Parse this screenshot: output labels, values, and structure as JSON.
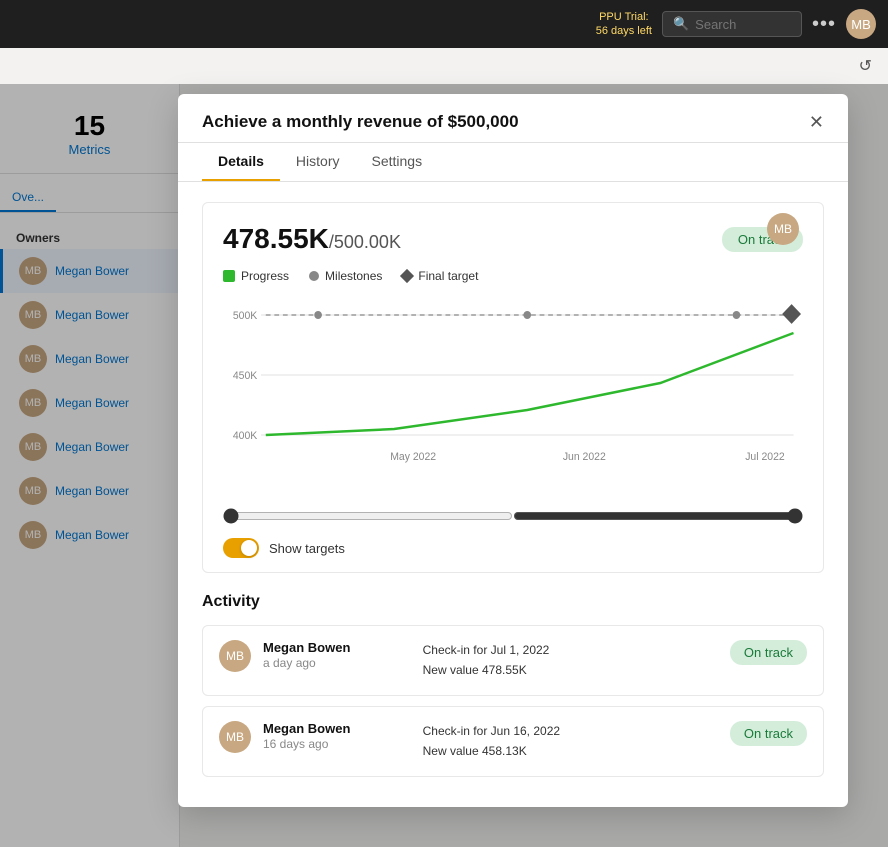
{
  "topbar": {
    "ppu_trial_line1": "PPU Trial:",
    "ppu_trial_line2": "56 days left",
    "search_placeholder": "Search",
    "more_icon": "•••",
    "avatar_initials": "MB"
  },
  "reload_icon": "↺",
  "sidebar": {
    "metrics_count": "15",
    "metrics_label": "Metrics",
    "tabs": [
      {
        "label": "Ove...",
        "active": false
      }
    ],
    "section_label": "Owners",
    "owners": [
      {
        "name": "Megan Bower",
        "selected": true
      },
      {
        "name": "Megan Bower",
        "selected": false
      },
      {
        "name": "Megan Bower",
        "selected": false
      },
      {
        "name": "Megan Bower",
        "selected": false
      },
      {
        "name": "Megan Bower",
        "selected": false
      },
      {
        "name": "Megan Bower",
        "selected": false
      },
      {
        "name": "Megan Bower",
        "selected": false
      }
    ]
  },
  "modal": {
    "title": "Achieve a monthly revenue of $500,000",
    "close_icon": "✕",
    "tabs": [
      {
        "label": "Details",
        "active": true
      },
      {
        "label": "History",
        "active": false
      },
      {
        "label": "Settings",
        "active": false
      }
    ],
    "chart": {
      "current_value": "478.55K",
      "separator": "/",
      "target_value": "500.00K",
      "badge": "On track",
      "legend": [
        {
          "type": "green-box",
          "label": "Progress"
        },
        {
          "type": "gray-dot",
          "label": "Milestones"
        },
        {
          "type": "diamond",
          "label": "Final target"
        }
      ],
      "y_labels": [
        "500K",
        "450K",
        "400K"
      ],
      "x_labels": [
        "May 2022",
        "Jun 2022",
        "Jul 2022"
      ],
      "toggle_label": "Show targets"
    },
    "activity": {
      "title": "Activity",
      "items": [
        {
          "name": "Megan Bowen",
          "time": "a day ago",
          "checkin": "Check-in for Jul 1, 2022",
          "new_value": "New value 478.55K",
          "badge": "On track"
        },
        {
          "name": "Megan Bowen",
          "time": "16 days ago",
          "checkin": "Check-in for Jun 16, 2022",
          "new_value": "New value 458.13K",
          "badge": "On track"
        }
      ]
    }
  }
}
